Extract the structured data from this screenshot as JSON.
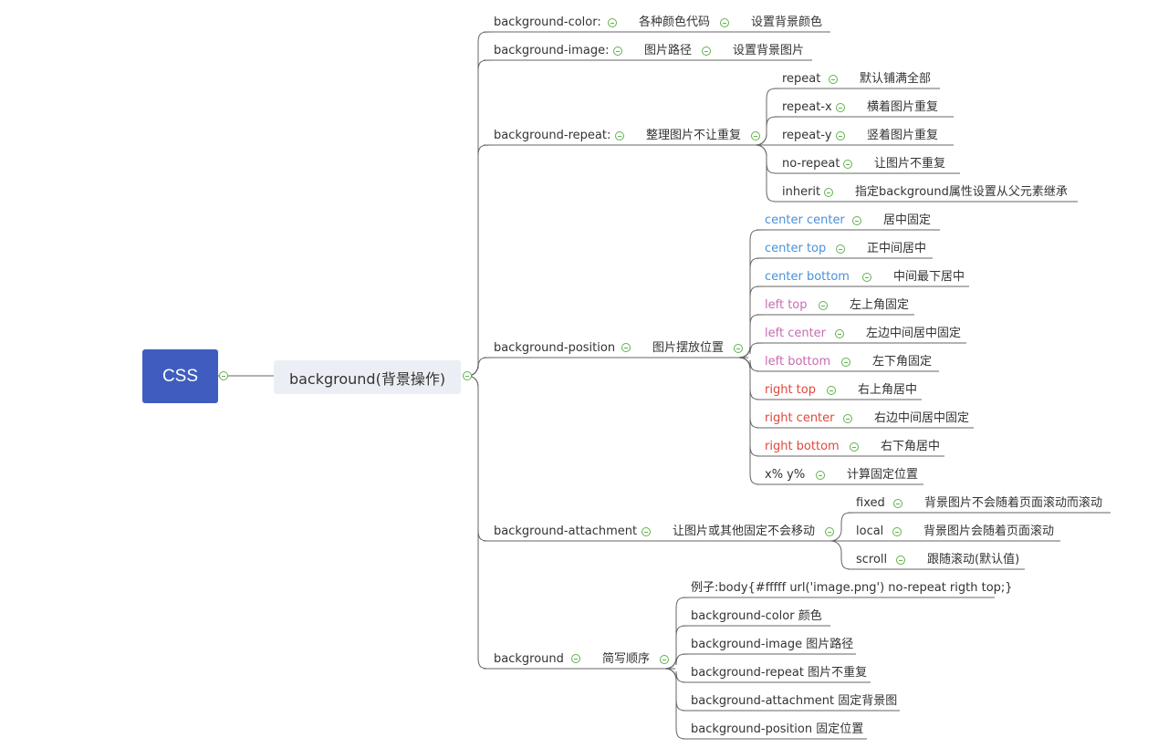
{
  "root": {
    "label": "CSS"
  },
  "main": {
    "label": "background(背景操作)"
  },
  "branches": {
    "color": {
      "label": "background-color:",
      "child": "各种颜色代码",
      "leaf": "设置背景颜色"
    },
    "image": {
      "label": "background-image:",
      "child": "图片路径",
      "leaf": "设置背景图片"
    },
    "repeat": {
      "label": "background-repeat:",
      "child": "整理图片不让重复",
      "items": [
        {
          "k": "repeat",
          "v": "默认铺满全部"
        },
        {
          "k": "repeat-x",
          "v": "横着图片重复"
        },
        {
          "k": "repeat-y",
          "v": "竖着图片重复"
        },
        {
          "k": "no-repeat",
          "v": "让图片不重复"
        },
        {
          "k": "inherit",
          "v": "指定background属性设置从父元素继承"
        }
      ]
    },
    "position": {
      "label": "background-position",
      "child": "图片摆放位置",
      "items": [
        {
          "k": "center center",
          "v": "居中固定",
          "color": "#4a90d9"
        },
        {
          "k": "center top",
          "v": "正中间居中",
          "color": "#4a90d9"
        },
        {
          "k": "center  bottom",
          "v": "中间最下居中",
          "color": "#4a90d9"
        },
        {
          "k": "left top",
          "v": "左上角固定",
          "color": "#c86bb0"
        },
        {
          "k": "left center",
          "v": "左边中间居中固定",
          "color": "#c86bb0"
        },
        {
          "k": "left bottom",
          "v": "左下角固定",
          "color": "#c86bb0"
        },
        {
          "k": "right top",
          "v": "右上角居中",
          "color": "#e0483a"
        },
        {
          "k": "right center",
          "v": "右边中间居中固定",
          "color": "#e0483a"
        },
        {
          "k": "right bottom",
          "v": "右下角居中",
          "color": "#e0483a"
        },
        {
          "k": "x% y%",
          "v": "计算固定位置",
          "color": "#333333"
        }
      ]
    },
    "attachment": {
      "label": "background-attachment",
      "child": "让图片或其他固定不会移动",
      "items": [
        {
          "k": "fixed",
          "v": "背景图片不会随着页面滚动而滚动"
        },
        {
          "k": "local",
          "v": "背景图片会随着页面滚动"
        },
        {
          "k": "scroll",
          "v": "跟随滚动(默认值)"
        }
      ]
    },
    "shorthand": {
      "label": "background",
      "child": "简写顺序",
      "items": [
        "例子:body{#fffff url('image.png') no-repeat rigth top;}",
        "background-color  颜色",
        "background-image 图片路径",
        "background-repeat 图片不重复",
        "background-attachment 固定背景图",
        "background-position 固定位置"
      ]
    }
  },
  "colors": {
    "line": "#555555",
    "toggle": "#5fb24a",
    "root_bg": "#3f5dbf",
    "main_bg": "#eceef5"
  }
}
